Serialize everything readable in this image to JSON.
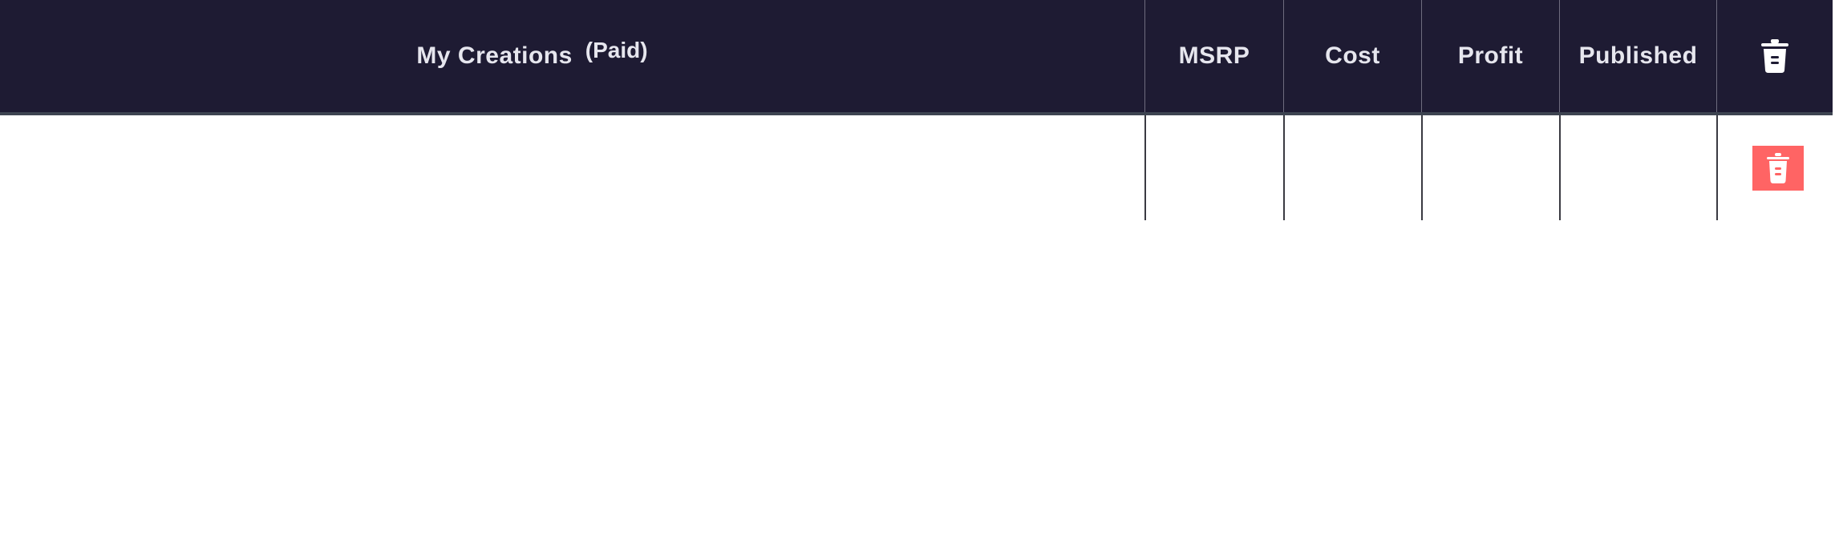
{
  "table": {
    "columns": {
      "name": "My Creations",
      "name_suffix": "(Paid)",
      "msrp": "MSRP",
      "cost": "Cost",
      "profit": "Profit",
      "published": "Published",
      "delete_icon": "trash-icon"
    },
    "rows": [
      {
        "name": "",
        "msrp": "",
        "cost": "",
        "profit": "",
        "published": "",
        "delete_icon": "trash-icon"
      }
    ]
  },
  "colors": {
    "header_background": "#1e1b33",
    "header_text": "#e6e6ee",
    "delete_button": "#ff6464"
  }
}
